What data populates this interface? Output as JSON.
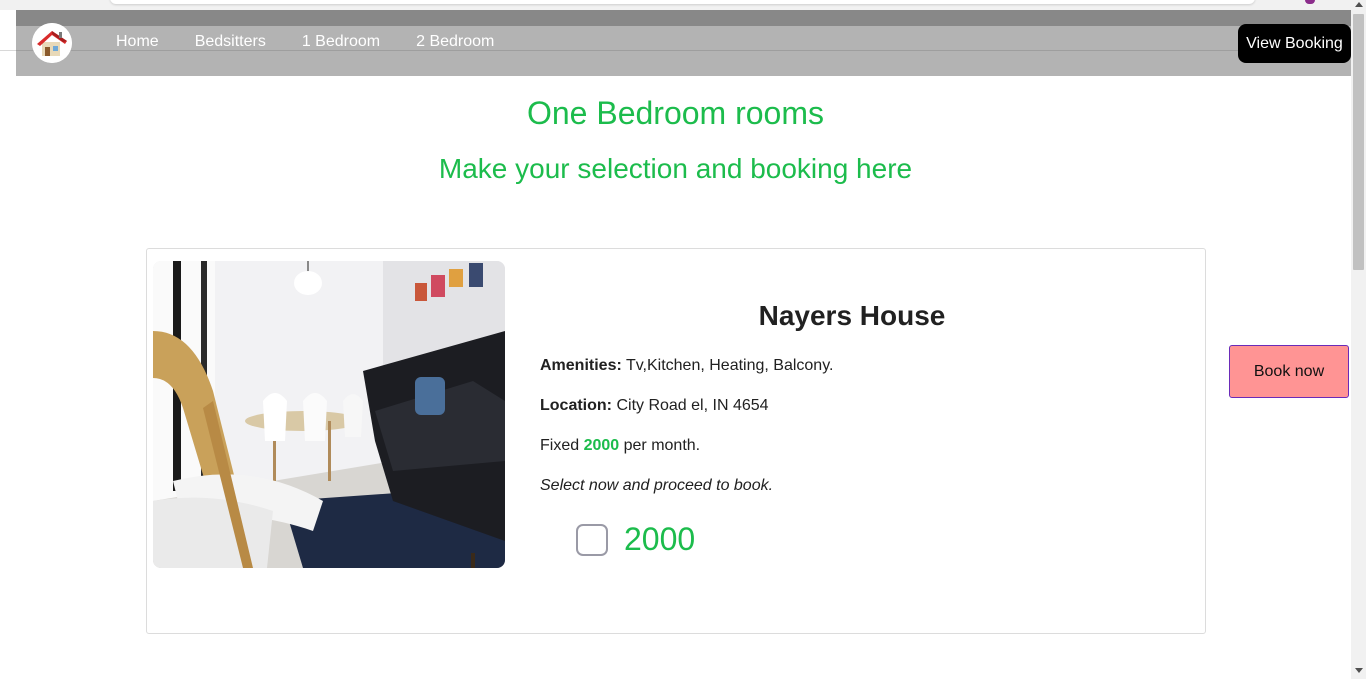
{
  "nav": {
    "logo_icon": "house-logo-icon",
    "links": [
      "Home",
      "Bedsitters",
      "1 Bedroom",
      "2 Bedroom"
    ],
    "view_booking_label": "View Booking"
  },
  "page": {
    "title": "One Bedroom rooms",
    "subtitle": "Make your selection and booking here"
  },
  "room": {
    "name": "Nayers House",
    "amenities_label": "Amenities:",
    "amenities_value": "Tv,Kitchen, Heating, Balcony.",
    "location_label": "Location:",
    "location_value": "City Road el, IN 4654",
    "price_prefix": "Fixed",
    "price": "2000",
    "price_suffix": "per month.",
    "hint": "Select now and proceed to book.",
    "checkbox_price": "2000",
    "checkbox_checked": false
  },
  "actions": {
    "book_now_label": "Book now"
  },
  "colors": {
    "accent_green": "#1cbc4c",
    "navbar": "#b3b3b3",
    "book_now_bg": "#ff9494"
  }
}
